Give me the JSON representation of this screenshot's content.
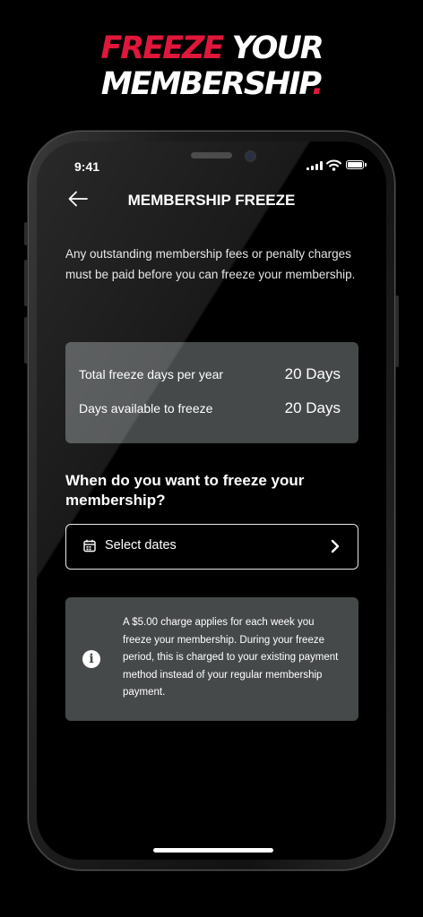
{
  "promo": {
    "headline_accent": "FREEZE",
    "headline_rest_1": " YOUR",
    "headline_rest_2": "MEMBERSHIP",
    "headline_dot": ".",
    "accent_color": "#e0173b"
  },
  "status_bar": {
    "time": "9:41"
  },
  "header": {
    "back_icon": "arrow-left-icon",
    "title": "MEMBERSHIP FREEZE"
  },
  "intro_text": "Any outstanding membership fees or penalty charges must be paid before you can freeze your membership.",
  "stats": [
    {
      "label": "Total freeze days per year",
      "value": "20 Days"
    },
    {
      "label": "Days available to freeze",
      "value": "20 Days"
    }
  ],
  "question": "When do you want to freeze your membership?",
  "date_select": {
    "label": "Select dates",
    "icon": "calendar-icon",
    "chevron": "chevron-right-icon"
  },
  "info": {
    "icon": "info-icon",
    "text": "A $5.00 charge applies for each week you freeze your membership. During your freeze period, this is charged to your existing payment method instead of your regular membership payment."
  },
  "colors": {
    "card_background": "#46494a",
    "screen_background": "#000000"
  }
}
